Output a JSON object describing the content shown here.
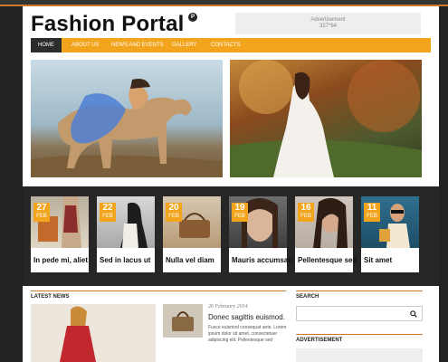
{
  "header": {
    "logo": "Fashion Portal",
    "logo_badge": "P",
    "ad_label": "Advertisement",
    "ad_size": "327*64"
  },
  "nav": {
    "items": [
      "Home",
      "About Us",
      "News and Events",
      "Gallery",
      "Contacts"
    ],
    "active": "Home"
  },
  "tiles": [
    {
      "day": "27",
      "month": "FEB",
      "caption": "In pede mi, aliet"
    },
    {
      "day": "22",
      "month": "FEB",
      "caption": "Sed in lacus ut"
    },
    {
      "day": "20",
      "month": "FEB",
      "caption": "Nulla vel diam"
    },
    {
      "day": "19",
      "month": "FEB",
      "caption": "Mauris accumsan"
    },
    {
      "day": "16",
      "month": "FEB",
      "caption": "Pellentesque sed"
    },
    {
      "day": "11",
      "month": "FEB",
      "caption": "Sit amet"
    }
  ],
  "latest_news": {
    "heading": "LATEST NEWS",
    "date": "26 February 2014",
    "title": "Donec sagittis euismod.",
    "excerpt": "Fusce euismod consequat ante. Lorem ipsum dolor sit amet, consectetuer adipiscing elit. Pellentesque sed"
  },
  "sidebar": {
    "search_heading": "SEARCH",
    "ad_heading": "ADVERTISEMENT"
  },
  "colors": {
    "accent": "#f2a41d",
    "accent_line": "#c8792e",
    "dark": "#262626"
  }
}
